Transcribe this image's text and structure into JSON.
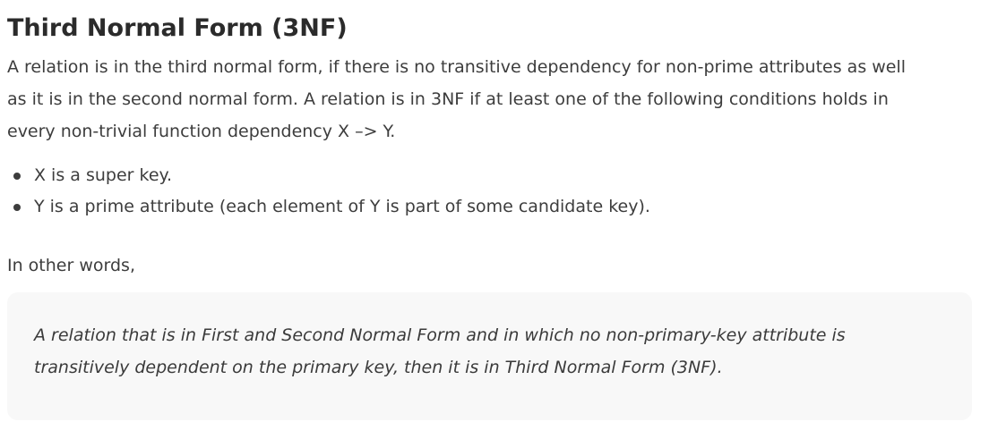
{
  "heading": "Third Normal Form (3NF)",
  "intro_lines": [
    "A relation is in the third normal form, if there is no transitive dependency for non-prime attributes as well",
    "as it is in the second normal form. A relation is in 3NF if at least one of the following conditions holds in",
    "every non-trivial function dependency X –> Y."
  ],
  "conditions": [
    "X is a super key.",
    "Y is a prime attribute (each element of Y is part of some candidate key)."
  ],
  "transition": "In other words,",
  "quote_lines": [
    "A relation that is in First and Second Normal Form and in which no non-primary-key attribute is",
    "transitively dependent on the primary key, then it is in Third Normal Form (3NF)."
  ]
}
